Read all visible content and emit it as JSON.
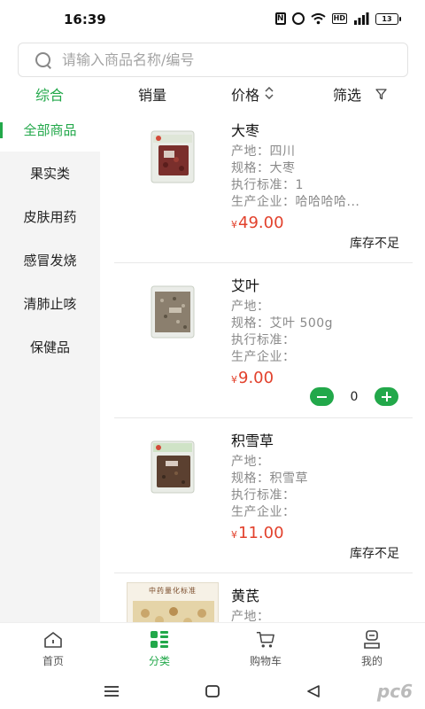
{
  "status_bar": {
    "time": "16:39",
    "battery": "13",
    "icons": [
      "nfc-icon",
      "alarm-icon",
      "wifi-icon",
      "hd-icon",
      "signal-icon",
      "battery-icon"
    ]
  },
  "search": {
    "placeholder": "请输入商品名称/编号",
    "value": ""
  },
  "sort_bar": {
    "tabs": [
      {
        "label": "综合",
        "active": true
      },
      {
        "label": "销量"
      },
      {
        "label": "价格"
      },
      {
        "label": "筛选"
      }
    ]
  },
  "sidebar": {
    "items": [
      {
        "label": "全部商品",
        "active": true
      },
      {
        "label": "果实类"
      },
      {
        "label": "皮肤用药"
      },
      {
        "label": "感冒发烧"
      },
      {
        "label": "清肺止咳"
      },
      {
        "label": "保健品"
      }
    ]
  },
  "products": [
    {
      "name": "大枣",
      "origin": "产地：四川",
      "spec": "规格：大枣",
      "standard": "执行标准：1",
      "maker": "生产企业：哈哈哈哈...",
      "price_symbol": "¥",
      "price": "49.00",
      "status": "库存不足"
    },
    {
      "name": "艾叶",
      "origin": "产地：",
      "spec": "规格：艾叶 500g",
      "standard": "执行标准：",
      "maker": "生产企业：",
      "price_symbol": "¥",
      "price": "9.00",
      "quantity": "0"
    },
    {
      "name": "积雪草",
      "origin": "产地：",
      "spec": "规格：积雪草",
      "standard": "执行标准：",
      "maker": "生产企业：",
      "price_symbol": "¥",
      "price": "11.00",
      "status": "库存不足"
    },
    {
      "name": "黄芪",
      "origin": "产地：",
      "image_text": "中药量化标准"
    }
  ],
  "bottom_nav": {
    "items": [
      {
        "label": "首页",
        "icon": "home-icon"
      },
      {
        "label": "分类",
        "icon": "category-icon",
        "active": true
      },
      {
        "label": "购物车",
        "icon": "cart-icon"
      },
      {
        "label": "我的",
        "icon": "profile-icon"
      }
    ]
  },
  "colors": {
    "accent": "#22a84a",
    "price": "#e2412c",
    "sidebar_bg": "#f4f4f4"
  }
}
